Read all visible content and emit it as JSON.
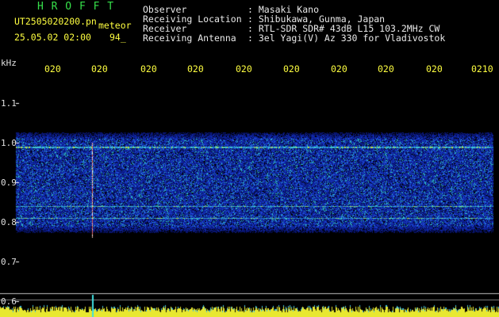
{
  "header": {
    "logo": "H R O F F T",
    "filename": "UT2505020200.pn",
    "type_label": "meteor",
    "datetime": "25.05.02 02:00",
    "count": "94_"
  },
  "info": {
    "labels": [
      "Observer",
      "Receiving Location",
      "Receiver",
      "Receiving Antenna"
    ],
    "values": [
      ": Masaki Kano",
      ": Shibukawa, Gunma, Japan",
      ": RTL-SDR SDR# 43dB L15 103.2MHz CW",
      ": 3el Yagi(V) Az 330 for Vladivostok"
    ]
  },
  "chart_data": {
    "type": "heatmap",
    "ylabel": "kHz",
    "y_ticks": [
      "1.1",
      "1.0",
      "0.9",
      "0.8",
      "0.7",
      "0.6"
    ],
    "x_ticks": [
      "020",
      "020",
      "020",
      "020",
      "020",
      "020",
      "020",
      "020",
      "020",
      "0210"
    ],
    "signal_lines_khz": [
      0.99,
      0.84,
      0.81
    ],
    "meteor_echo": {
      "time_fraction": 0.16,
      "band_khz": [
        0.78,
        1.0
      ]
    },
    "colors": {
      "background": "#000000",
      "noise": "#1030c0",
      "signal": "#40e0c0",
      "axis": "#ffff40"
    }
  }
}
